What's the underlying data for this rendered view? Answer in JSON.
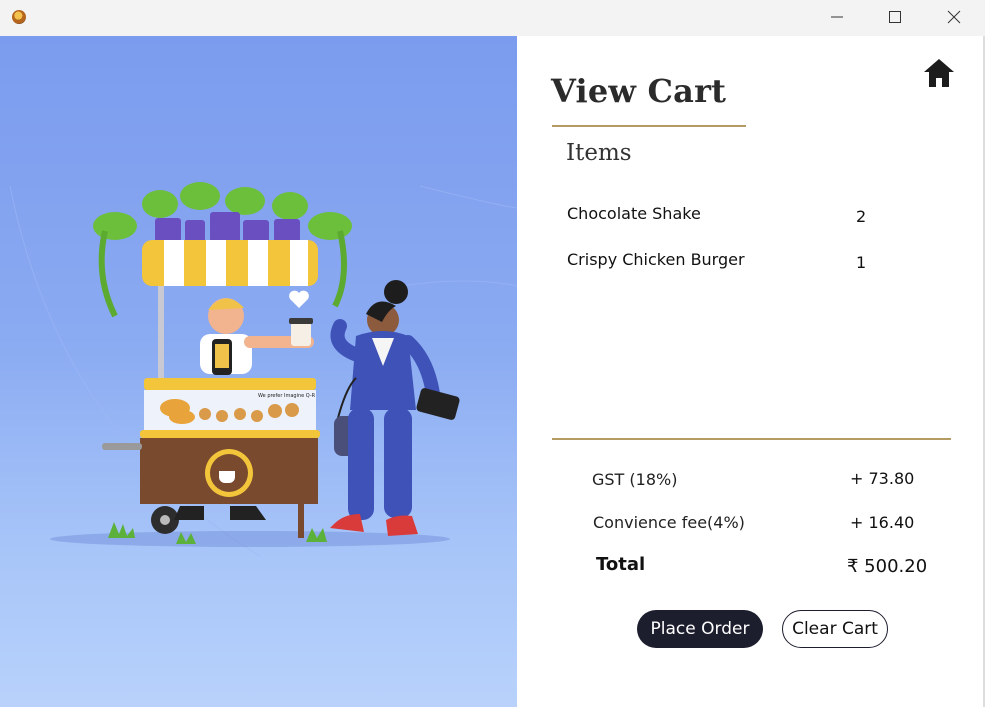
{
  "window": {
    "app_icon": "food-app-logo-icon",
    "controls": [
      "minimize-icon",
      "maximize-icon",
      "close-icon"
    ]
  },
  "illustration": {
    "banner_text": "We prefer Imagine Q-R"
  },
  "cart": {
    "title": "View Cart",
    "items_heading": "Items",
    "home_icon": "home-icon",
    "items": [
      {
        "name": "Chocolate Shake",
        "qty": "2"
      },
      {
        "name": "Crispy Chicken Burger",
        "qty": "1"
      }
    ],
    "summary": {
      "gst_label": "GST (18%)",
      "gst_value": "+ 73.80",
      "fee_label": "Convience fee(4%)",
      "fee_value": "+ 16.40",
      "total_label": "Total",
      "total_value": "₹ 500.20"
    },
    "actions": {
      "place_order": "Place Order",
      "clear_cart": "Clear Cart"
    }
  },
  "colors": {
    "accent_rule": "#b49a63",
    "primary_button": "#1c1e2e",
    "illustration_bg": "#7b9bee"
  }
}
